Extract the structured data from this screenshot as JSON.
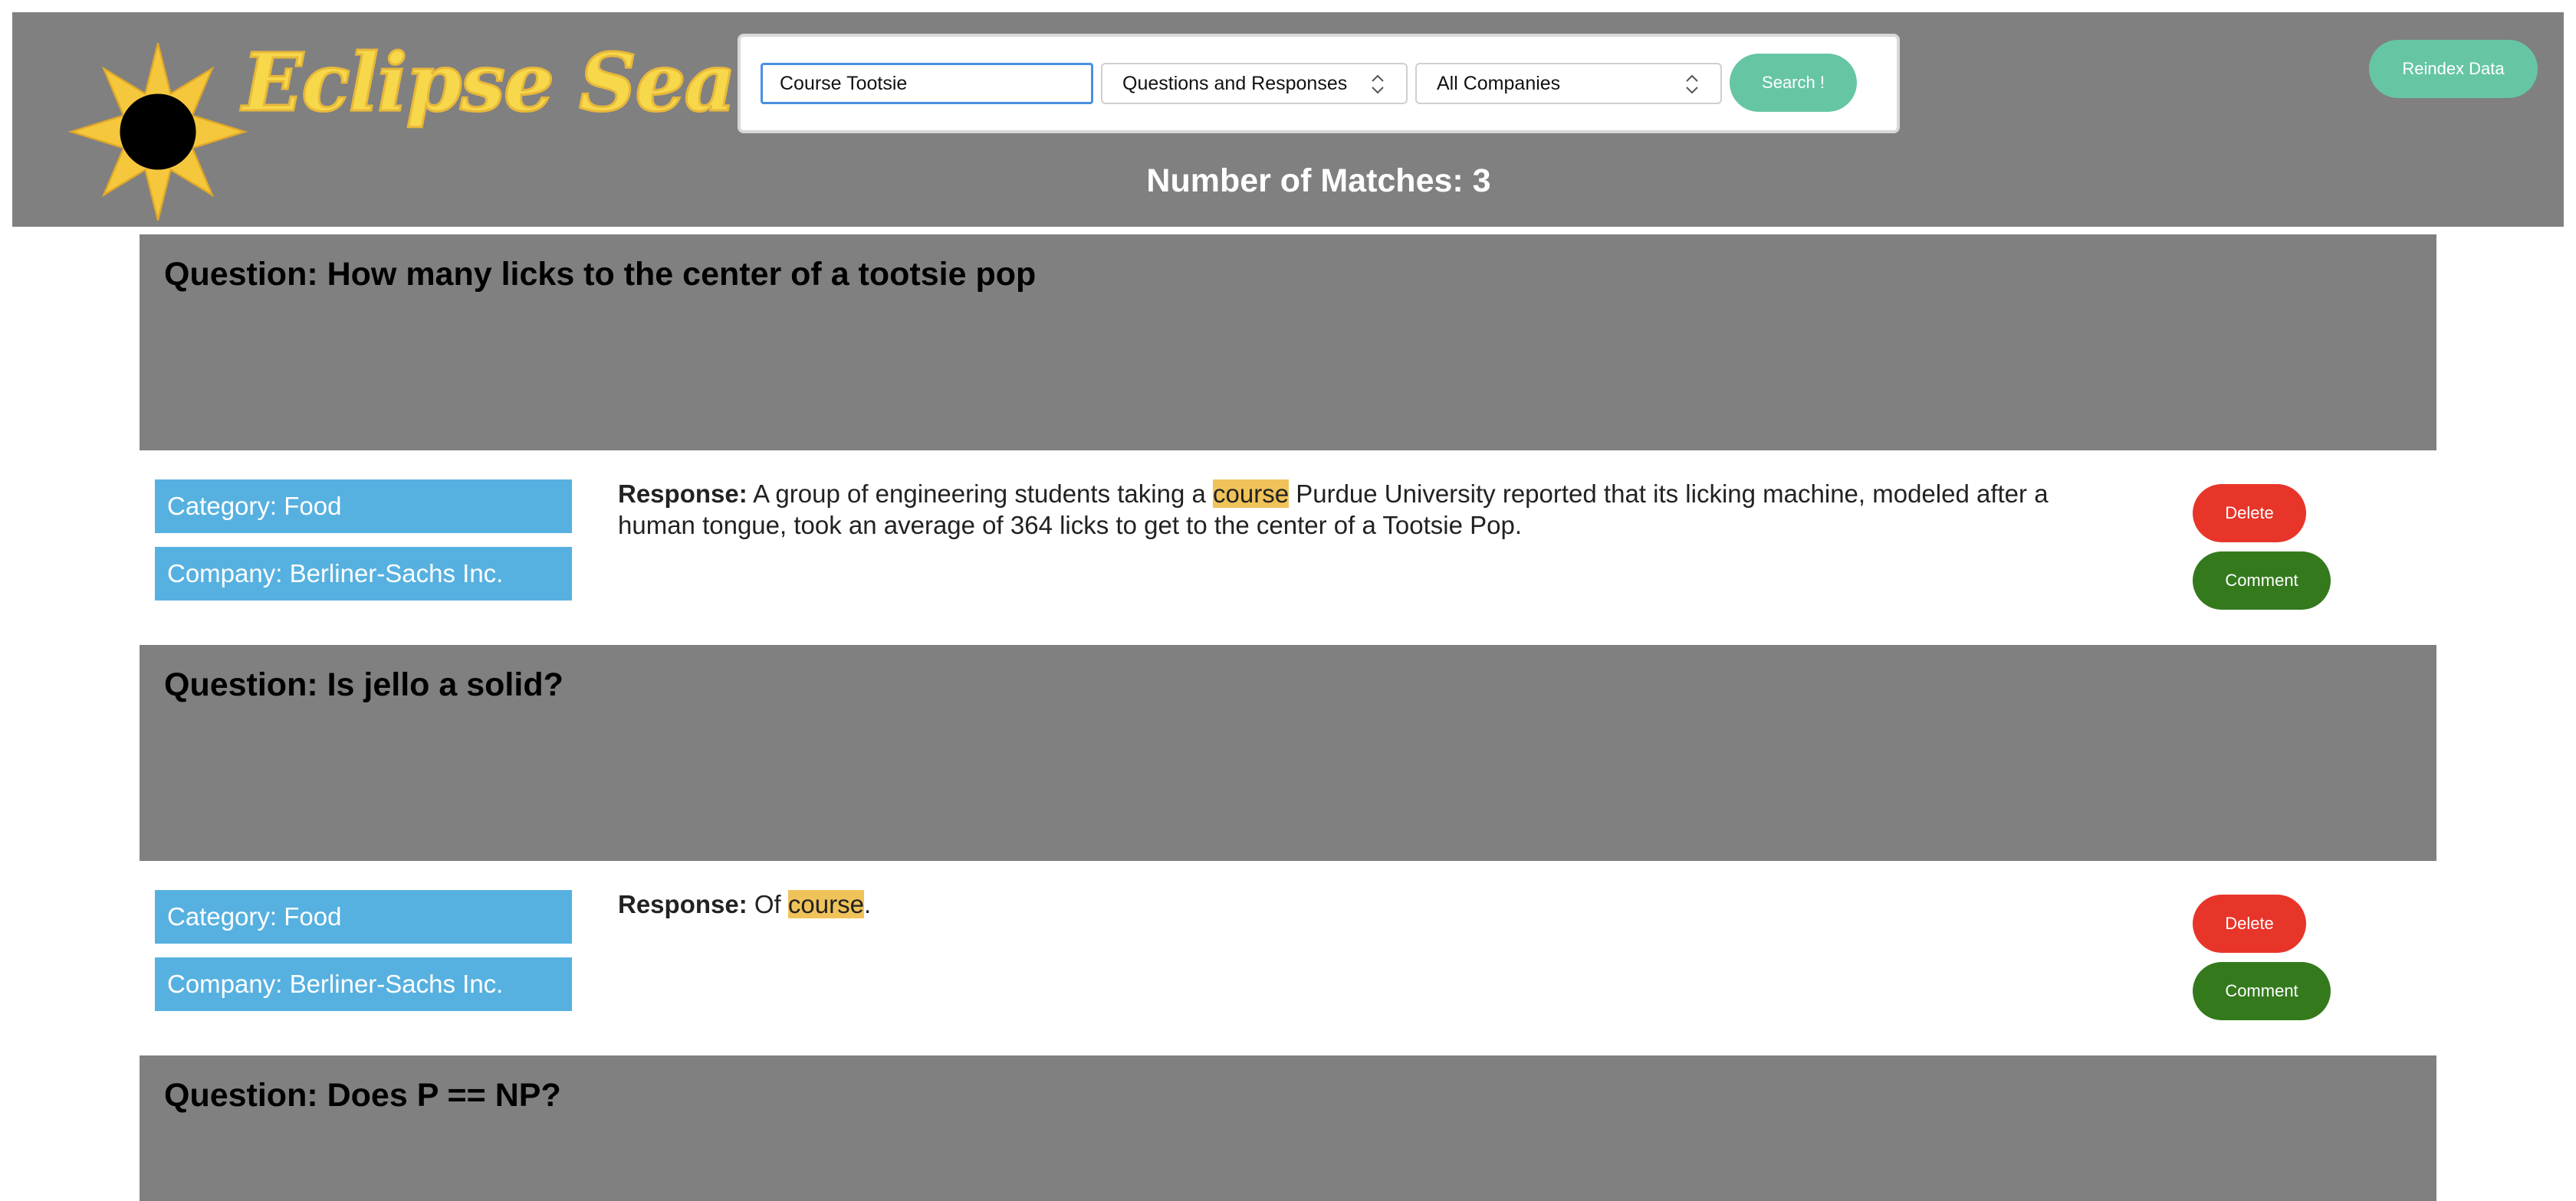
{
  "app": {
    "title": "Eclipse Search"
  },
  "search": {
    "query": "Course Tootsie",
    "mode": "Questions and Responses",
    "company": "All Companies",
    "search_label": "Search !"
  },
  "reindex_label": "Reindex Data",
  "match_count": "Number of Matches: 3",
  "results": [
    {
      "question": "Question: How many licks to the center of a tootsie pop",
      "category": "Category: Food",
      "company": "Company: Berliner-Sachs Inc.",
      "response_label": "Response:",
      "response_before": " A group of engineering students taking a ",
      "response_highlight": "course",
      "response_after": " Purdue University reported that its licking machine, modeled after a human tongue, took an average of 364 licks to get to the center of a Tootsie Pop.",
      "delete_label": "Delete",
      "comment_label": "Comment"
    },
    {
      "question": "Question: Is jello a solid?",
      "category": "Category: Food",
      "company": "Company: Berliner-Sachs Inc.",
      "response_label": "Response:",
      "response_before": " Of ",
      "response_highlight": "course",
      "response_after": ".",
      "delete_label": "Delete",
      "comment_label": "Comment"
    },
    {
      "question": "Question: Does P == NP?"
    }
  ],
  "colors": {
    "header_bg": "#808080",
    "logo_yellow": "#f7d84b",
    "accent_green": "#66c6a4",
    "tag_blue": "#56b1e0",
    "delete_red": "#e8352a",
    "comment_green": "#347a1d",
    "highlight": "#f0c35a"
  },
  "icons": {
    "logo": "eclipse-sun-icon",
    "select_arrow": "updown-chevron-icon"
  }
}
